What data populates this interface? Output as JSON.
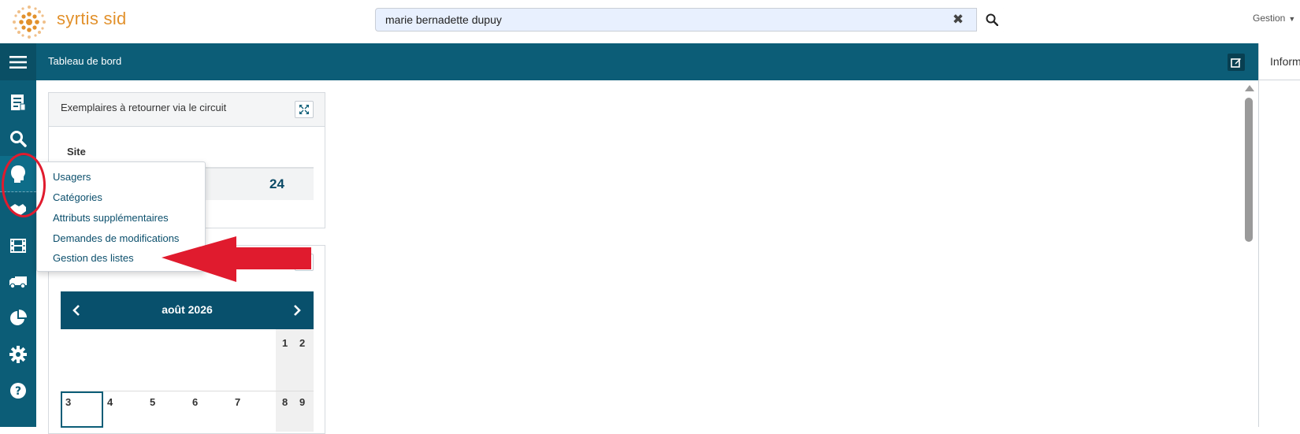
{
  "app": {
    "brand_name": "syrtis sid",
    "colors": {
      "primary": "#0c5d77",
      "brand_orange": "#e2912c",
      "annotation_red": "#e01b2e"
    }
  },
  "search": {
    "value": "marie bernadette dupuy",
    "clear_icon": "close-icon",
    "search_icon": "search-icon"
  },
  "user_menu": {
    "label": "Gestion"
  },
  "header": {
    "title": "Tableau de bord"
  },
  "right_panel": {
    "title": "Inform"
  },
  "sidebar": {
    "items": [
      {
        "name": "sidebar-item-catalogue",
        "icon": "document-icon"
      },
      {
        "name": "sidebar-item-search",
        "icon": "search-icon"
      },
      {
        "name": "sidebar-item-usagers",
        "icon": "user-head-icon",
        "active": true
      },
      {
        "name": "sidebar-item-prets",
        "icon": "handshake-icon"
      },
      {
        "name": "sidebar-item-media",
        "icon": "film-icon"
      },
      {
        "name": "sidebar-item-transport",
        "icon": "truck-icon"
      },
      {
        "name": "sidebar-item-stats",
        "icon": "pie-chart-icon"
      },
      {
        "name": "sidebar-item-settings",
        "icon": "gear-icon"
      },
      {
        "name": "sidebar-item-help",
        "icon": "help-icon"
      }
    ]
  },
  "widget_returns": {
    "title": "Exemplaires à retourner via le circuit",
    "column_header": "Site",
    "row_value": "24"
  },
  "calendar": {
    "month_label": "août 2026",
    "week1": [
      "1",
      "2"
    ],
    "week2": [
      "3",
      "4",
      "5",
      "6",
      "7",
      "8",
      "9"
    ]
  },
  "dropdown_menu": {
    "items": [
      "Usagers",
      "Catégories",
      "Attributs supplémentaires",
      "Demandes de modifications",
      "Gestion des listes"
    ]
  }
}
